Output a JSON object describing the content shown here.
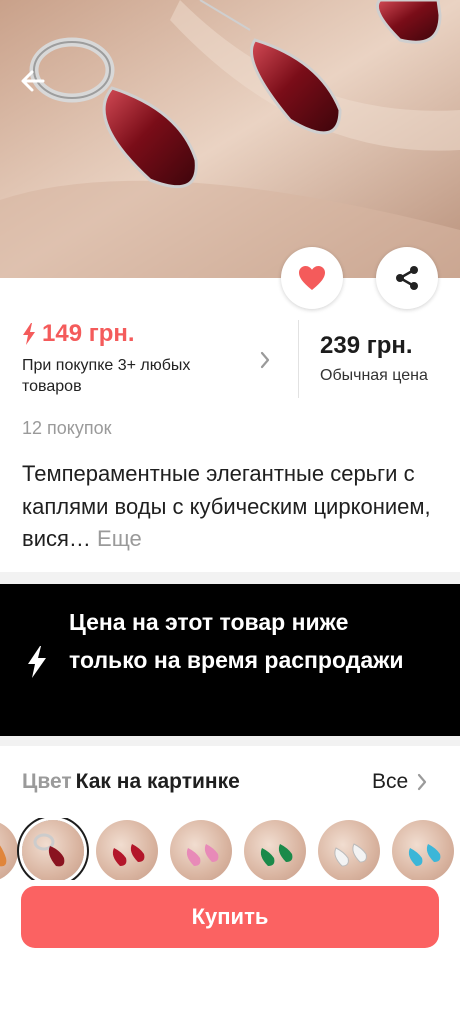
{
  "header": {
    "back_icon": "arrow-left-icon"
  },
  "actions": {
    "favorite_icon": "heart-icon",
    "share_icon": "share-icon",
    "favorite_color": "#f45b5b"
  },
  "price": {
    "sale_price": "149 грн.",
    "sale_icon": "lightning-icon",
    "sale_note": "При покупке 3+ любых товаров",
    "regular_price": "239 грн.",
    "regular_label": "Обычная цена",
    "accent_color": "#f45b5b"
  },
  "purchases": "12 покупок",
  "product": {
    "title": "Темпераментные элегантные серьги с каплями воды с кубическим цирконием, вися…",
    "more_label": "Еще"
  },
  "promo": {
    "icon": "lightning-icon",
    "text": "Цена на этот товар ниже только на время распродажи"
  },
  "color": {
    "label": "Цвет",
    "value": "Как на картинке",
    "all_label": "Все",
    "swatches": [
      "orange",
      "red",
      "red",
      "pink",
      "green",
      "white",
      "blue"
    ]
  },
  "buy": {
    "label": "Купить",
    "color": "#fb6262"
  }
}
